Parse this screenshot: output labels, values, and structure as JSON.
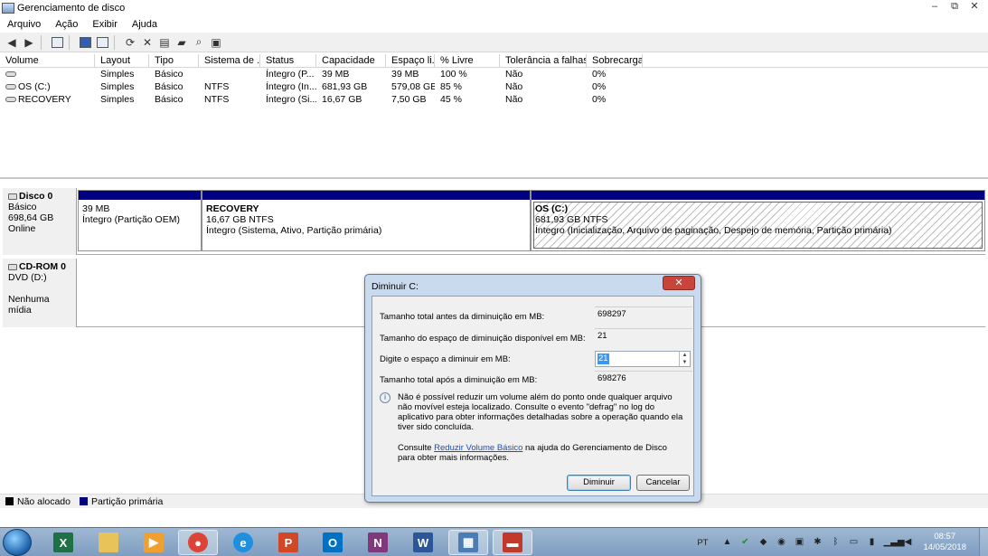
{
  "window": {
    "title": "Gerenciamento de disco",
    "controls": [
      "▭",
      "⧉",
      "✕"
    ]
  },
  "menu": [
    "Arquivo",
    "Ação",
    "Exibir",
    "Ajuda"
  ],
  "toolbar": {
    "icons": [
      "back-icon",
      "forward-icon",
      "console-tree-icon",
      "help-icon",
      "list-view-icon",
      "refresh-icon",
      "delete-icon",
      "properties-icon",
      "open-icon",
      "explore-icon",
      "settings-icon"
    ]
  },
  "volumes": {
    "headers": [
      "Volume",
      "Layout",
      "Tipo",
      "Sistema de ...",
      "Status",
      "Capacidade",
      "Espaço li...",
      "% Livre",
      "Tolerância a falhas",
      "Sobrecarga"
    ],
    "rows": [
      [
        "",
        "Simples",
        "Básico",
        "",
        "Íntegro (P...",
        "39 MB",
        "39 MB",
        "100 %",
        "Não",
        "0%"
      ],
      [
        "OS (C:)",
        "Simples",
        "Básico",
        "NTFS",
        "Íntegro (In...",
        "681,93 GB",
        "579,08 GB",
        "85 %",
        "Não",
        "0%"
      ],
      [
        "RECOVERY",
        "Simples",
        "Básico",
        "NTFS",
        "Íntegro (Si...",
        "16,67 GB",
        "7,50 GB",
        "45 %",
        "Não",
        "0%"
      ]
    ]
  },
  "disk0": {
    "name": "Disco 0",
    "type": "Básico",
    "size": "698,64 GB",
    "state": "Online",
    "partitions": [
      {
        "name": "",
        "size": "39 MB",
        "status": "Íntegro (Partição OEM)"
      },
      {
        "name": "RECOVERY",
        "size": "16,67 GB NTFS",
        "status": "Íntegro (Sistema, Ativo, Partição primária)"
      },
      {
        "name": "OS  (C:)",
        "size": "681,93 GB NTFS",
        "status": "Íntegro (Inicialização, Arquivo de paginação, Despejo de memória, Partição primária)"
      }
    ]
  },
  "cdrom": {
    "name": "CD-ROM 0",
    "drive": "DVD (D:)",
    "media": "Nenhuma mídia"
  },
  "legend": [
    {
      "label": "Não alocado",
      "color": "#000000"
    },
    {
      "label": "Partição primária",
      "color": "#000080"
    }
  ],
  "dialog": {
    "title": "Diminuir C:",
    "close": "✕",
    "fields": [
      {
        "label": "Tamanho total antes da diminuição em MB:",
        "value": "698297"
      },
      {
        "label": "Tamanho do espaço de diminuição disponível em MB:",
        "value": "21"
      },
      {
        "label": "Digite o espaço a diminuir em MB:",
        "value": "21"
      },
      {
        "label": "Tamanho total após a diminuição em MB:",
        "value": "698276"
      }
    ],
    "info": "Não é possível reduzir um volume além do ponto onde qualquer arquivo não movível esteja localizado. Consulte o evento \"defrag\" no log do aplicativo para obter informações detalhadas sobre a operação quando ela tiver sido concluída.",
    "help_prefix": "Consulte ",
    "help_link": "Reduzir Volume Básico",
    "help_suffix": " na ajuda do Gerenciamento de Disco para obter mais informações.",
    "ok": "Diminuir",
    "cancel": "Cancelar"
  },
  "taskbar": {
    "apps": [
      {
        "name": "excel",
        "glyph": "X",
        "color": "#1e7145"
      },
      {
        "name": "file-explorer",
        "glyph": "",
        "color": "#e8c35a"
      },
      {
        "name": "media-player",
        "glyph": "▶",
        "color": "#f0a030"
      },
      {
        "name": "chrome",
        "glyph": "●",
        "color": "#db4437"
      },
      {
        "name": "internet-explorer",
        "glyph": "e",
        "color": "#1f8fe0"
      },
      {
        "name": "powerpoint",
        "glyph": "P",
        "color": "#d24726"
      },
      {
        "name": "outlook",
        "glyph": "O",
        "color": "#0072c6"
      },
      {
        "name": "onenote",
        "glyph": "N",
        "color": "#80397b"
      },
      {
        "name": "word",
        "glyph": "W",
        "color": "#2b579a"
      },
      {
        "name": "remote-desktop",
        "glyph": "▦",
        "color": "#4a7db3"
      },
      {
        "name": "toolbox",
        "glyph": "▬",
        "color": "#c0392b"
      }
    ],
    "lang": "PT",
    "time": "08:57",
    "date": "14/05/2018"
  }
}
